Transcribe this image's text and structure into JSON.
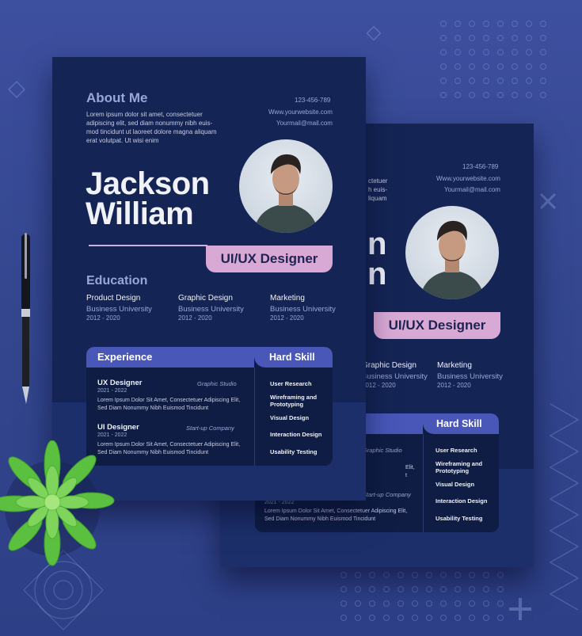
{
  "resume": {
    "about_title": "About Me",
    "about_text": [
      "Lorem ipsum dolor sit amet, consectetuer",
      "adipiscing elit, sed diam nonummy nibh euis-",
      "mod tincidunt ut laoreet dolore magna aliquam",
      "erat volutpat. Ut wisi enim"
    ],
    "contact": {
      "phone": "123-456-789",
      "website": "Www.yourwebsite.com",
      "email": "Yourmail@mail.com"
    },
    "first_name": "Jackson",
    "last_name": "William",
    "role": "UI/UX Designer",
    "education_title": "Education",
    "education": [
      {
        "field": "Product Design",
        "school": "Business University",
        "years": "2012 - 2020"
      },
      {
        "field": "Graphic Design",
        "school": "Business University",
        "years": "2012 - 2020"
      },
      {
        "field": "Marketing",
        "school": "Business University",
        "years": "2012 - 2020"
      }
    ],
    "experience_title": "Experience",
    "experience": [
      {
        "title": "UX Designer",
        "years": "2021 - 2022",
        "company": "Graphic Studio",
        "desc": [
          "Lorem Ipsum Dolor Sit Amet, Consectetuer Adipiscing Elit,",
          "Sed Diam Nonummy Nibh Euismod Tincidunt"
        ]
      },
      {
        "title": "UI Designer",
        "years": "2021 - 2022",
        "company": "Start-up Company",
        "desc": [
          "Lorem Ipsum Dolor Sit Amet, Consectetuer Adipiscing Elit,",
          "Sed Diam Nonummy Nibh Euismod Tincidunt"
        ]
      }
    ],
    "hard_skill_title": "Hard Skill",
    "skills": [
      "User Research",
      "Wireframing and Prototyping",
      "Visual Design",
      "Interaction Design",
      "Usability Testing"
    ]
  },
  "back_sheet": {
    "about_text": [
      "ctetuer",
      "h euis-",
      "liquam"
    ],
    "name_fragment": "n",
    "education": [
      {
        "field": "Graphic Design",
        "school": "Business University",
        "years": "2012 - 2020"
      }
    ],
    "experience_fragment": {
      "company1": "Graphic Studio",
      "desc1": [
        "Elit,",
        "t"
      ],
      "company2": "Start-up Company",
      "years": "2021 - 2022",
      "desc2": [
        "Lorem Ipsum Dolor Sit Amet, Consectetuer Adipiscing Elit,",
        "Sed Diam Nonummy Nibh Euismod Tincidunt"
      ]
    }
  },
  "colors": {
    "background": "#34478f",
    "sheet": "#142454",
    "accent_pink": "#d9a9d6",
    "accent_blue": "#4857b8",
    "lavender_text": "#9aa7d6"
  },
  "icons": [
    "pen-icon",
    "succulent-plant-icon",
    "profile-photo"
  ]
}
